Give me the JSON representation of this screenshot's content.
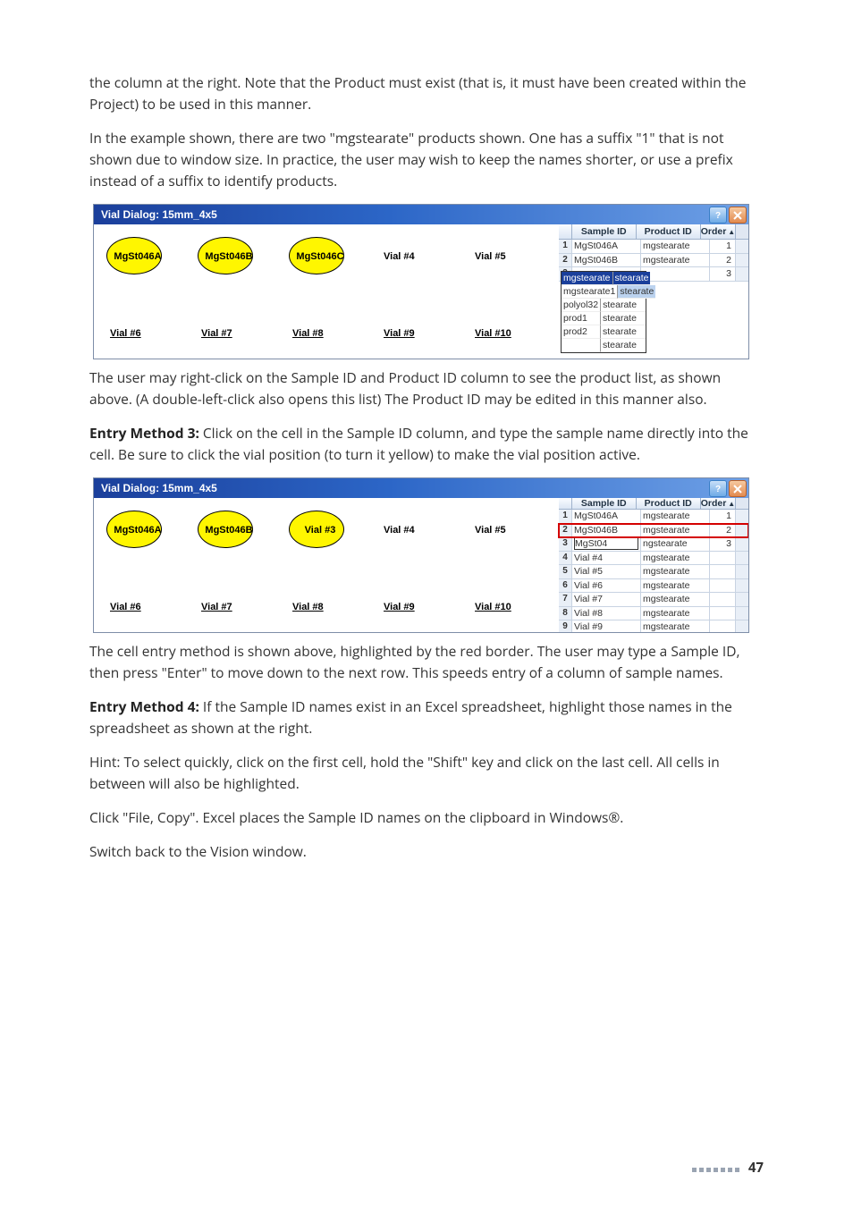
{
  "paragraphs": {
    "p1": "the column at the right. Note that the Product must exist (that is, it must have been created within the Project) to be used in this manner.",
    "p2": "In the example shown, there are two \"mgstearate\" products shown. One has a suffix \"1\" that is not shown due to window size. In practice, the user may wish to keep the names shorter, or use a prefix instead of a suffix to identify products.",
    "p3": "The user may right-click on the Sample ID and Product ID column to see the product list, as shown above. (A double-left-click also opens this list) The Product ID may be edited in this manner also.",
    "m3_label": "Entry Method 3:",
    "m3_text": " Click on the cell in the Sample ID column, and type the sample name directly into the cell. Be sure to click the vial position (to turn it yellow) to make the vial position active.",
    "p5": "The cell entry method is shown above, highlighted by the red border. The user may type a Sample ID, then press \"Enter\" to move down to the next row. This speeds entry of a column of sample names.",
    "m4_label": "Entry Method 4:",
    "m4_text": " If the Sample ID names exist in an Excel spreadsheet, highlight those names in the spreadsheet as shown at the right.",
    "p7": "Hint: To select quickly, click on the first cell, hold the \"Shift\" key and click on the last cell. All cells in between will also be highlighted.",
    "p8": "Click \"File, Copy\". Excel places the Sample ID names on the clipboard in Windows®.",
    "p9": "Switch back to the Vision window."
  },
  "dialog": {
    "title": "Vial Dialog: 15mm_4x5",
    "headers": {
      "sample": "Sample ID",
      "product": "Product ID",
      "order": "Order"
    }
  },
  "fig1": {
    "row1": [
      {
        "label": "MgSt046A",
        "active": true
      },
      {
        "label": "MgSt046B",
        "active": true
      },
      {
        "label": "MgSt046C",
        "active": true
      },
      {
        "label": "Vial #4",
        "active": false
      },
      {
        "label": "Vial #5",
        "active": false
      }
    ],
    "row2": [
      {
        "label": "Vial #6"
      },
      {
        "label": "Vial #7"
      },
      {
        "label": "Vial #8"
      },
      {
        "label": "Vial #9"
      },
      {
        "label": "Vial #10"
      }
    ],
    "grid": [
      {
        "n": "1",
        "a": "MgSt046A",
        "b": "mgstearate",
        "c": "1"
      },
      {
        "n": "2",
        "a": "MgSt046B",
        "b": "mgstearate",
        "c": "2"
      },
      {
        "n": "3",
        "a": "",
        "b": "",
        "c": "3"
      }
    ],
    "dropdown": [
      {
        "a": "mgstearate",
        "b": "stearate",
        "sel": true
      },
      {
        "a": "mgstearate1",
        "b": "stearate",
        "hl": true
      },
      {
        "a": "polyol32",
        "b": "stearate"
      },
      {
        "a": "prod1",
        "b": "stearate"
      },
      {
        "a": "prod2",
        "b": "stearate"
      },
      {
        "a": "",
        "b": "stearate"
      }
    ]
  },
  "fig2": {
    "row1": [
      {
        "label": "MgSt046A",
        "active": true
      },
      {
        "label": "MgSt046B",
        "active": true
      },
      {
        "label": "Vial #3",
        "active": true
      },
      {
        "label": "Vial #4",
        "active": false
      },
      {
        "label": "Vial #5",
        "active": false
      }
    ],
    "row2": [
      {
        "label": "Vial #6"
      },
      {
        "label": "Vial #7"
      },
      {
        "label": "Vial #8"
      },
      {
        "label": "Vial #9"
      },
      {
        "label": "Vial #10"
      }
    ],
    "grid": [
      {
        "n": "1",
        "a": "MgSt046A",
        "b": "mgstearate",
        "c": "1"
      },
      {
        "n": "2",
        "a": "MgSt046B",
        "b": "mgstearate",
        "c": "2",
        "red": true
      },
      {
        "n": "3",
        "a": "MgSt04",
        "b": "ngstearate",
        "c": "3",
        "edit": true
      },
      {
        "n": "4",
        "a": "Vial #4",
        "b": "mgstearate",
        "c": ""
      },
      {
        "n": "5",
        "a": "Vial #5",
        "b": "mgstearate",
        "c": ""
      },
      {
        "n": "6",
        "a": "Vial #6",
        "b": "mgstearate",
        "c": ""
      },
      {
        "n": "7",
        "a": "Vial #7",
        "b": "mgstearate",
        "c": ""
      },
      {
        "n": "8",
        "a": "Vial #8",
        "b": "mgstearate",
        "c": ""
      },
      {
        "n": "9",
        "a": "Vial #9",
        "b": "mgstearate",
        "c": ""
      }
    ]
  },
  "page_number": "47"
}
